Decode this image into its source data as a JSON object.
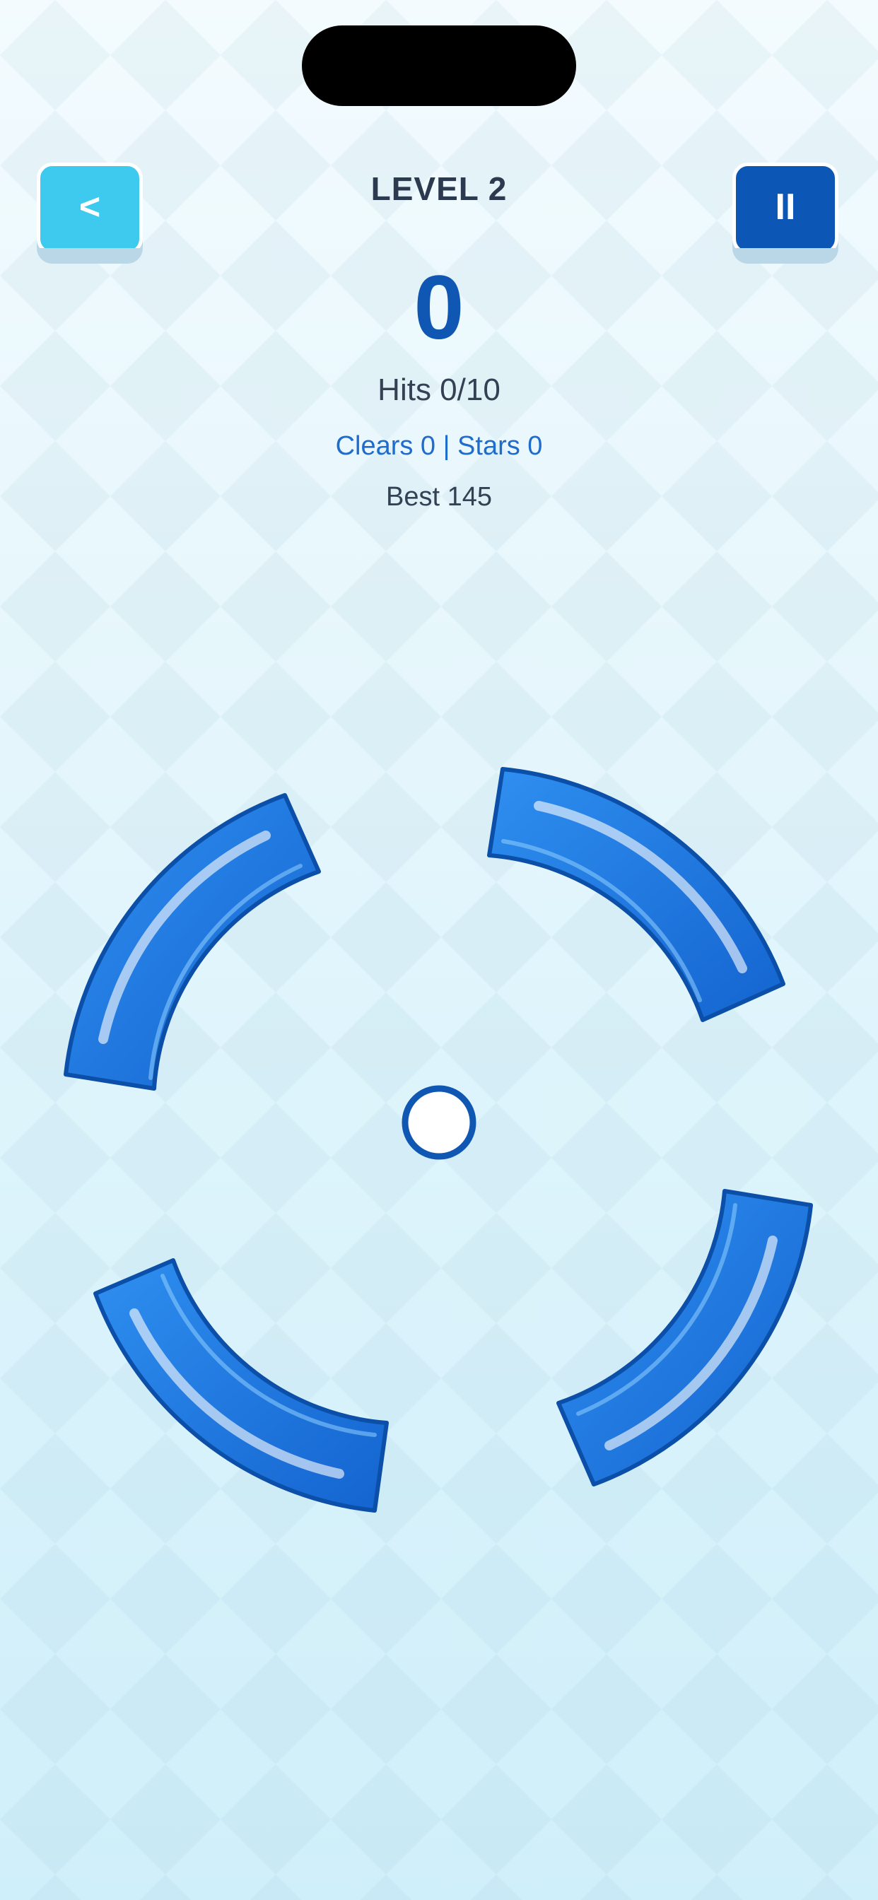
{
  "header": {
    "back_label": "<",
    "pause_label": "II",
    "level_title": "LEVEL 2"
  },
  "stats": {
    "score": "0",
    "hits": "Hits 0/10",
    "clears_stars": "Clears 0 | Stars 0",
    "best": "Best 145"
  },
  "colors": {
    "back_button": "#3ec9ef",
    "pause_button": "#0c57b5",
    "score": "#0f57b2",
    "clears_text": "#1e6ccc",
    "segment_fill": "#1f78de",
    "segment_dark": "#0b4fa8",
    "target_ring": "#0f57b2"
  },
  "icons": {
    "back": "chevron-left-icon",
    "pause": "pause-icon",
    "target": "center-ring-icon"
  }
}
